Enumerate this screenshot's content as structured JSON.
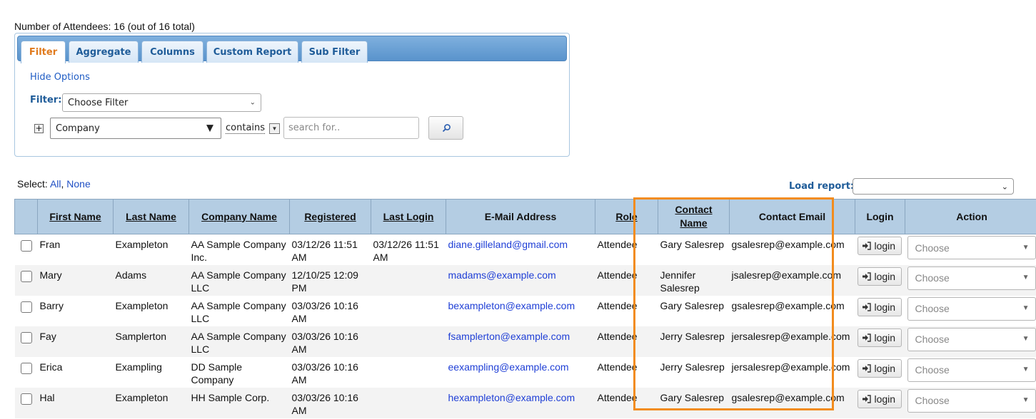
{
  "header": {
    "attendee_count_text": "Number of Attendees: 16 (out of 16 total)"
  },
  "tabs": [
    {
      "label": "Filter",
      "active": true
    },
    {
      "label": "Aggregate"
    },
    {
      "label": "Columns"
    },
    {
      "label": "Custom Report"
    },
    {
      "label": "Sub Filter"
    }
  ],
  "options": {
    "hide_options_label": "Hide Options",
    "filter_label": "Filter:",
    "filter_select_value": "Choose Filter",
    "field_select_value": "Company",
    "operator_label": "contains",
    "search_placeholder": "search for.."
  },
  "selection": {
    "select_label": "Select:",
    "all_label": "All",
    "separator": ",",
    "none_label": "None"
  },
  "load_report": {
    "label": "Load report:",
    "value": ""
  },
  "table": {
    "columns": [
      "",
      "First Name",
      "Last Name",
      "Company Name",
      "Registered",
      "Last Login",
      "E-Mail Address",
      "Role",
      "Contact Name",
      "Contact Email",
      "Login",
      "Action"
    ],
    "login_button_label": "login",
    "action_placeholder": "Choose",
    "rows": [
      {
        "first": "Fran",
        "last": "Exampleton",
        "company": "AA Sample Company Inc.",
        "registered": "03/12/26 11:51 AM",
        "last_login": "03/12/26 11:51 AM",
        "email": "diane.gilleland@gmail.com",
        "role": "Attendee",
        "contact_name": "Gary Salesrep",
        "contact_email": "gsalesrep@example.com"
      },
      {
        "first": "Mary",
        "last": "Adams",
        "company": "AA Sample Company LLC",
        "registered": "12/10/25 12:09 PM",
        "last_login": "",
        "email": "madams@example.com",
        "role": "Attendee",
        "contact_name": "Jennifer Salesrep",
        "contact_email": "jsalesrep@example.com"
      },
      {
        "first": "Barry",
        "last": "Exampleton",
        "company": "AA Sample Company LLC",
        "registered": "03/03/26 10:16 AM",
        "last_login": "",
        "email": "bexampleton@example.com",
        "role": "Attendee",
        "contact_name": "Gary Salesrep",
        "contact_email": "gsalesrep@example.com"
      },
      {
        "first": "Fay",
        "last": "Samplerton",
        "company": "AA Sample Company LLC",
        "registered": "03/03/26 10:16 AM",
        "last_login": "",
        "email": "fsamplerton@example.com",
        "role": "Attendee",
        "contact_name": "Jerry Salesrep",
        "contact_email": "jersalesrep@example.com"
      },
      {
        "first": "Erica",
        "last": "Exampling",
        "company": "DD Sample Company",
        "registered": "03/03/26 10:16 AM",
        "last_login": "",
        "email": "eexampling@example.com",
        "role": "Attendee",
        "contact_name": "Jerry Salesrep",
        "contact_email": "jersalesrep@example.com"
      },
      {
        "first": "Hal",
        "last": "Exampleton",
        "company": "HH Sample Corp.",
        "registered": "03/03/26 10:16 AM",
        "last_login": "",
        "email": "hexampleton@example.com",
        "role": "Attendee",
        "contact_name": "Gary Salesrep",
        "contact_email": "gsalesrep@example.com"
      }
    ]
  },
  "colors": {
    "accent_tab_text": "#e07a1d",
    "link": "#1f4fc4",
    "header_bg": "#b4cde3",
    "highlight_border": "#f28c1e"
  },
  "icons": [
    "search-icon",
    "login-icon",
    "plus-icon",
    "chevron-down-icon"
  ]
}
